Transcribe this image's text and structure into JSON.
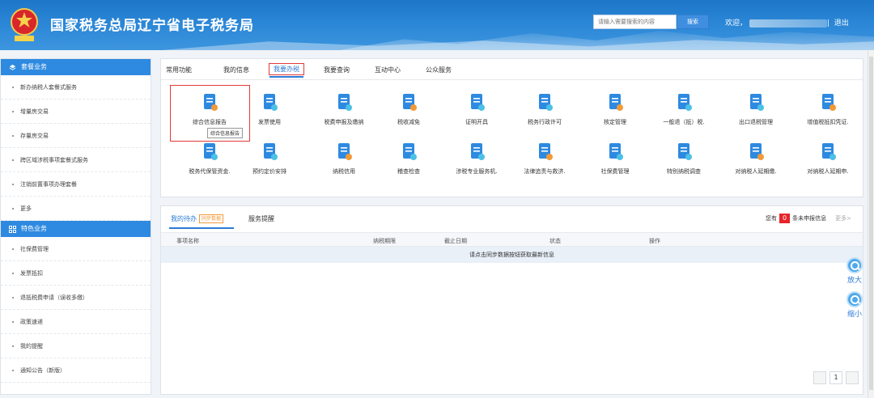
{
  "header": {
    "title": "国家税务总局辽宁省电子税务局",
    "search_placeholder": "请输入需要搜索的内容",
    "search_button": "搜索",
    "welcome": "欢迎，",
    "logout_sep": "|",
    "logout": "退出"
  },
  "sidebar": {
    "group1_title": "套餐业务",
    "group1_items": [
      "新办纳税人套餐式服务",
      "增量房交易",
      "存量房交易",
      "跨区域涉税事项套餐式服务",
      "注销前置事项办理套餐",
      "更多"
    ],
    "group2_title": "特色业务",
    "group2_items": [
      "社保费管理",
      "发票抵扣",
      "退抵税费申请（误收多缴）",
      "政策速递",
      "我的提醒",
      "通知公告（新版）"
    ]
  },
  "tabs": [
    "常用功能",
    "我的信息",
    "我要办税",
    "我要查询",
    "互动中心",
    "公众服务"
  ],
  "active_tab": "我要办税",
  "services_row1": [
    "综合信息报告",
    "发票使用",
    "税费申报及缴纳",
    "税收减免",
    "证明开具",
    "税务行政许可",
    "核定管理",
    "一般退（抵）税.",
    "出口退税管理",
    "增值税抵扣凭证."
  ],
  "services_row2": [
    "税务代保管资金.",
    "预约定价安排",
    "纳税信用",
    "稽查检查",
    "涉税专业服务机.",
    "法律追责与救济.",
    "社保费管理",
    "特别纳税调查",
    "对纳税人延期缴.",
    "对纳税人延期申."
  ],
  "tooltip": "综合信息报告",
  "bottom": {
    "tab_todo": "我的待办",
    "sync_badge": "同步数据",
    "tab_remind": "服务提醒",
    "notice_prefix": "您有",
    "notice_count": "0",
    "notice_suffix": "条未申报信息",
    "more": "更多>",
    "columns": [
      "事项名称",
      "纳税期限",
      "截止日期",
      "状态",
      "操作"
    ],
    "empty_message": "请点击同步数据按钮获取最新信息",
    "page": "1"
  },
  "zoom": {
    "in_label": "放大",
    "out_label": "缩小"
  },
  "colors": {
    "brand_blue": "#2e8ae0",
    "highlight_red": "#e23a3a",
    "badge_orange": "#f29a38"
  }
}
